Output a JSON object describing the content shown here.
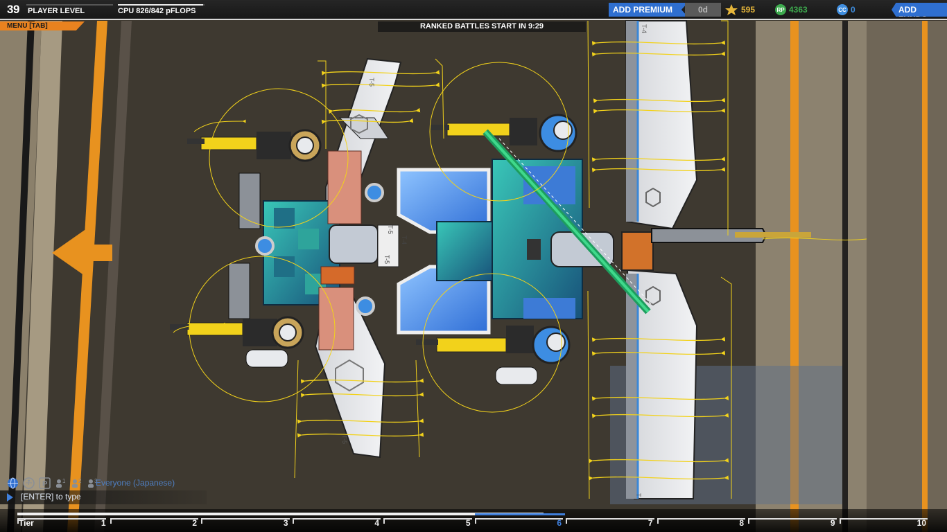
{
  "hud": {
    "player_level": "39",
    "player_level_label": "PLAYER LEVEL",
    "cpu_label": "CPU 826/842 pFLOPS",
    "cpu_fraction": 0.981,
    "add_premium": "ADD PREMIUM",
    "premium_days": "0d",
    "robits": "595",
    "robit_icon": "star-trophy-icon",
    "rp": "4363",
    "rp_icon": "RP",
    "cc": "0",
    "cc_icon": "CC",
    "add_funds": "ADD FUNDS",
    "menu": "MENU [TAB]",
    "ranked_banner": "RANKED BATTLES START IN  9:29"
  },
  "robot_labels": {
    "t5_a": "T-5",
    "t5_b": "T-5",
    "t5_c": "T-5",
    "t5_d": "T-5",
    "t5_e": "T-5",
    "t4_a": "T-4",
    "t4_b": "T-4"
  },
  "chat": {
    "channel": "Everyone (Japanese)",
    "input_placeholder": "[ENTER] to type",
    "icons": [
      "globe-icon",
      "accessibility-icon",
      "party-p-icon",
      "group1-icon",
      "group2-icon",
      "group3-icon"
    ],
    "group1_num": "1",
    "group2_num": "2",
    "group3_num": "3",
    "party_letter": "P"
  },
  "tier": {
    "label": "Tier",
    "numbers": [
      "1",
      "2",
      "3",
      "4",
      "5",
      "6",
      "7",
      "8",
      "9",
      "10"
    ],
    "current_tier": "6",
    "progress_fraction": 0.577
  },
  "colors": {
    "accent_blue": "#2f6fd0",
    "menu_orange": "#e8821f",
    "robit_gold": "#e5b53a",
    "rp_green": "#3daa4e",
    "cc_blue": "#3f8ee0",
    "thruster_yellow": "#f2d21b",
    "floor_stripe_orange": "#e89226"
  }
}
